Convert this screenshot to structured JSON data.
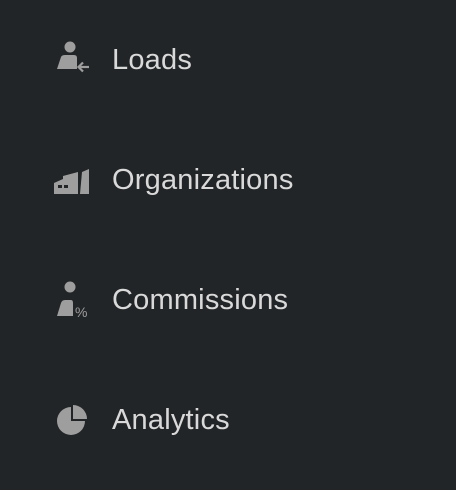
{
  "nav": {
    "items": [
      {
        "label": "Loads",
        "icon": "person-arrow-left-icon"
      },
      {
        "label": "Organizations",
        "icon": "factory-icon"
      },
      {
        "label": "Commissions",
        "icon": "person-percent-icon"
      },
      {
        "label": "Analytics",
        "icon": "pie-chart-icon"
      }
    ]
  },
  "colors": {
    "background": "#222527",
    "text": "#d9d9d9",
    "icon": "#9e9e9e"
  }
}
